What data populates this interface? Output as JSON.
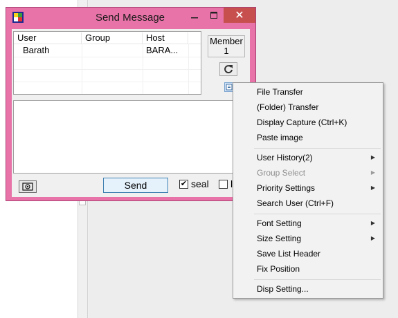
{
  "window": {
    "title": "Send Message",
    "minimize_icon": "minimize-icon",
    "maximize_icon": "maximize-icon",
    "close_label": "✕"
  },
  "user_list": {
    "columns": [
      "User",
      "Group",
      "Host"
    ],
    "rows": [
      {
        "user": "Barath",
        "group": "",
        "host": "BARA..."
      }
    ]
  },
  "member": {
    "label": "Member",
    "count": "1"
  },
  "compose": {
    "send_label": "Send",
    "seal_label": "seal",
    "seal_checked": true,
    "lock_label": "lo",
    "lock_checked": false
  },
  "context_menu": {
    "items": [
      {
        "label": "File Transfer"
      },
      {
        "label": "(Folder) Transfer"
      },
      {
        "label": "Display Capture (Ctrl+K)"
      },
      {
        "label": "Paste image"
      },
      {
        "label": "User History(2)",
        "submenu": true
      },
      {
        "label": "Group Select",
        "submenu": true,
        "disabled": true
      },
      {
        "label": "Priority Settings",
        "submenu": true
      },
      {
        "label": "Search User (Ctrl+F)"
      },
      {
        "label": "Font Setting",
        "submenu": true
      },
      {
        "label": "Size Setting",
        "submenu": true
      },
      {
        "label": "Save List Header"
      },
      {
        "label": "Fix Position"
      },
      {
        "label": "Disp Setting..."
      }
    ]
  },
  "colors": {
    "window_frame": "#e873a8",
    "close_button": "#c7504f",
    "send_border": "#3c7fb1"
  }
}
